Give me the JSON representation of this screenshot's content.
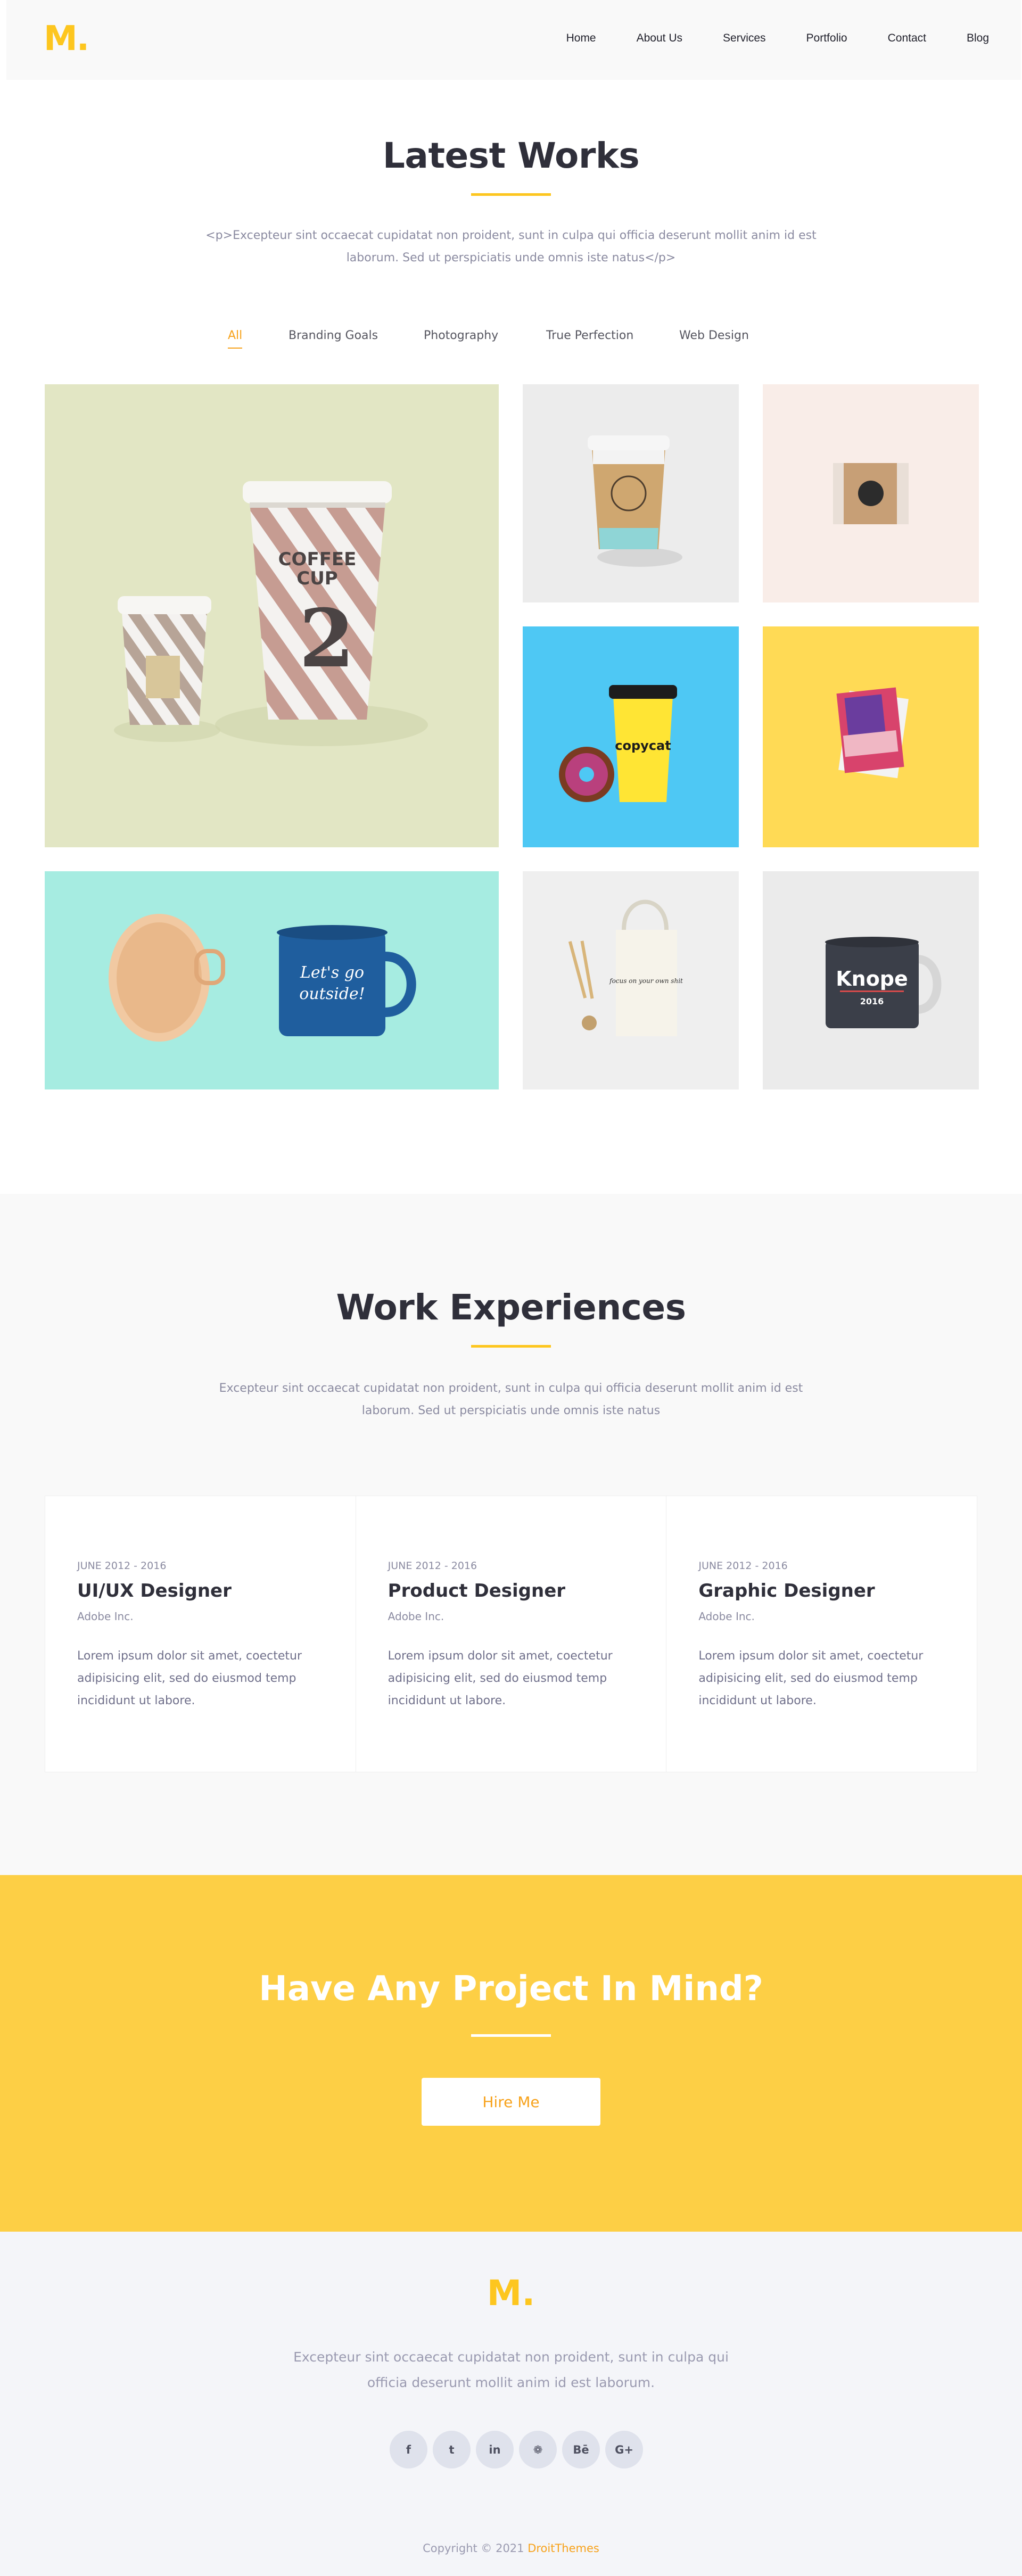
{
  "header": {
    "logo": "M.",
    "nav": [
      "Home",
      "About Us",
      "Services",
      "Portfolio",
      "Contact",
      "Blog"
    ]
  },
  "works": {
    "title": "Latest Works",
    "intro": "<p>Excepteur sint occaecat cupidatat non proident, sunt in culpa qui officia deserunt mollit anim id est laborum. Sed ut perspiciatis unde omnis iste natus</p>",
    "filters": [
      "All",
      "Branding Goals",
      "Photography",
      "True Perfection",
      "Web Design"
    ],
    "active_filter": "All",
    "tiles": [
      {
        "name": "coffee-cups",
        "bg": "#e2e6c4",
        "cup_text_1": "COFFEE",
        "cup_text_2": "CUP",
        "cup_number": "2"
      },
      {
        "name": "kraft-cup",
        "bg": "#ececec"
      },
      {
        "name": "box",
        "bg": "#f9ede8"
      },
      {
        "name": "copycat-cup",
        "bg": "#4ec8f4",
        "label": "copycat"
      },
      {
        "name": "cards",
        "bg": "#ffda55"
      },
      {
        "name": "mugs",
        "bg": "#a6ece1",
        "mug_text_1": "Let's go",
        "mug_text_2": "outside!"
      },
      {
        "name": "tote-bag",
        "bg": "#efefef",
        "bag_text": "focus on your own shit"
      },
      {
        "name": "knope-mug",
        "bg": "#ebebeb",
        "mug_text": "Knope",
        "mug_year": "2016"
      }
    ]
  },
  "experience": {
    "title": "Work Experiences",
    "intro": "Excepteur sint occaecat cupidatat non proident, sunt in culpa qui officia deserunt mollit anim id est laborum. Sed ut perspiciatis unde omnis iste natus",
    "cards": [
      {
        "date": "JUNE 2012 - 2016",
        "role": "UI/UX Designer",
        "company": "Adobe Inc.",
        "desc": "Lorem ipsum dolor sit amet, coectetur adipisicing elit, sed do eiusmod temp incididunt ut labore."
      },
      {
        "date": "JUNE 2012 - 2016",
        "role": "Product Designer",
        "company": "Adobe Inc.",
        "desc": "Lorem ipsum dolor sit amet, coectetur adipisicing elit, sed do eiusmod temp incididunt ut labore."
      },
      {
        "date": "JUNE 2012 - 2016",
        "role": "Graphic Designer",
        "company": "Adobe Inc.",
        "desc": "Lorem ipsum dolor sit amet, coectetur adipisicing elit, sed do eiusmod temp incididunt ut labore."
      }
    ]
  },
  "cta": {
    "title": "Have Any Project In Mind?",
    "button": "Hire Me"
  },
  "footer": {
    "logo": "M.",
    "text": "Excepteur sint occaecat cupidatat non proident, sunt in culpa qui officia deserunt mollit anim id est laborum.",
    "socials": [
      {
        "icon": "facebook-icon",
        "glyph": "f"
      },
      {
        "icon": "twitter-icon",
        "glyph": "t"
      },
      {
        "icon": "linkedin-icon",
        "glyph": "in"
      },
      {
        "icon": "dribbble-icon",
        "glyph": "❁"
      },
      {
        "icon": "behance-icon",
        "glyph": "Bē"
      },
      {
        "icon": "google-plus-icon",
        "glyph": "G+"
      }
    ],
    "copyright_prefix": "Copyright © 2021 ",
    "copyright_brand": "DroitThemes"
  },
  "colors": {
    "accent": "#fdc61f",
    "accent_dark": "#f7a21b",
    "cta_bg": "#fdcf45",
    "text_dark": "#2f2f3a",
    "text_muted": "#8a8aa0"
  }
}
